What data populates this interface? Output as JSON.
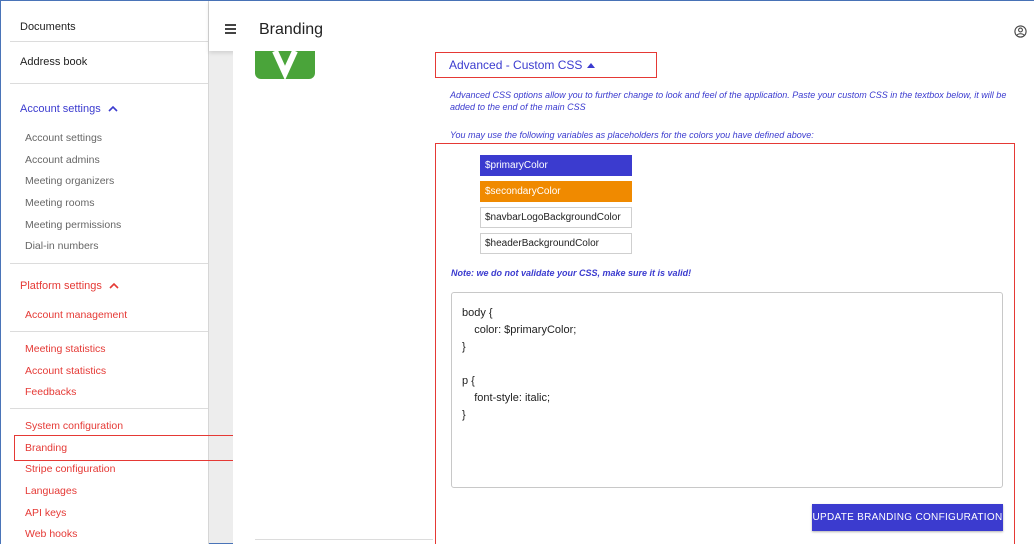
{
  "sidebar": {
    "top_links": [
      "Documents",
      "Address book"
    ],
    "account_section": {
      "label": "Account settings",
      "items": [
        "Account settings",
        "Account admins",
        "Meeting organizers",
        "Meeting rooms",
        "Meeting permissions",
        "Dial-in numbers"
      ]
    },
    "platform_section": {
      "label": "Platform settings",
      "group1": [
        "Account management"
      ],
      "group2": [
        "Meeting statistics",
        "Account statistics",
        "Feedbacks"
      ],
      "group3": [
        "System configuration",
        "Branding",
        "Stripe configuration",
        "Languages",
        "API keys",
        "Web hooks"
      ]
    },
    "active_item": "Branding"
  },
  "header": {
    "title": "Branding",
    "menu_icon": "hamburger-menu-icon",
    "user_icon": "account-circle-icon"
  },
  "main": {
    "advanced_toggle_label": "Advanced - Custom CSS",
    "description": "Advanced CSS options allow you to further change to look and feel of the application. Paste your custom CSS in the textbox below, it will be added to the end of the main CSS",
    "variables_intro": "You may use the following variables as placeholders for the colors you have defined above:",
    "variables": [
      "$primaryColor",
      "$secondaryColor",
      "$navbarLogoBackgroundColor",
      "$headerBackgroundColor"
    ],
    "note": "Note: we do not validate your CSS, make sure it is valid!",
    "css_code": "body {\n    color: $primaryColor;\n}\n\np {\n    font-style: italic;\n}",
    "update_button": "UPDATE BRANDING CONFIGURATION"
  },
  "colors": {
    "primary": "#3b3bcf",
    "secondary": "#f08a00",
    "accent_red": "#e53935",
    "logo_green": "#4aa43a"
  }
}
